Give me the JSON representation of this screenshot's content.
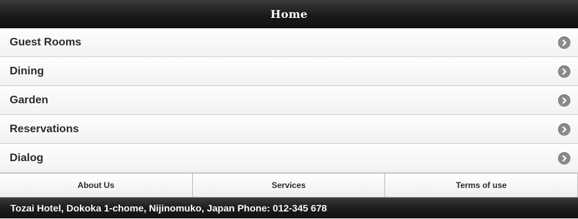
{
  "header": {
    "title": "Home"
  },
  "menu": {
    "items": [
      {
        "label": "Guest Rooms",
        "icon": "chevron-right-icon"
      },
      {
        "label": "Dining",
        "icon": "chevron-right-icon"
      },
      {
        "label": "Garden",
        "icon": "chevron-right-icon"
      },
      {
        "label": "Reservations",
        "icon": "chevron-right-icon"
      },
      {
        "label": "Dialog",
        "icon": "chevron-right-icon"
      }
    ]
  },
  "navbar": {
    "about_label": "About Us",
    "services_label": "Services",
    "terms_label": "Terms of use"
  },
  "footer": {
    "text": "Tozai Hotel, Dokoka 1-chome, Nijinomuko, Japan Phone: 012-345 678"
  },
  "colors": {
    "header_bg": "#1a1a1a",
    "list_bg": "#f6f6f6",
    "arrow_bg": "#8a8a8a",
    "text": "#2a2a2a"
  }
}
